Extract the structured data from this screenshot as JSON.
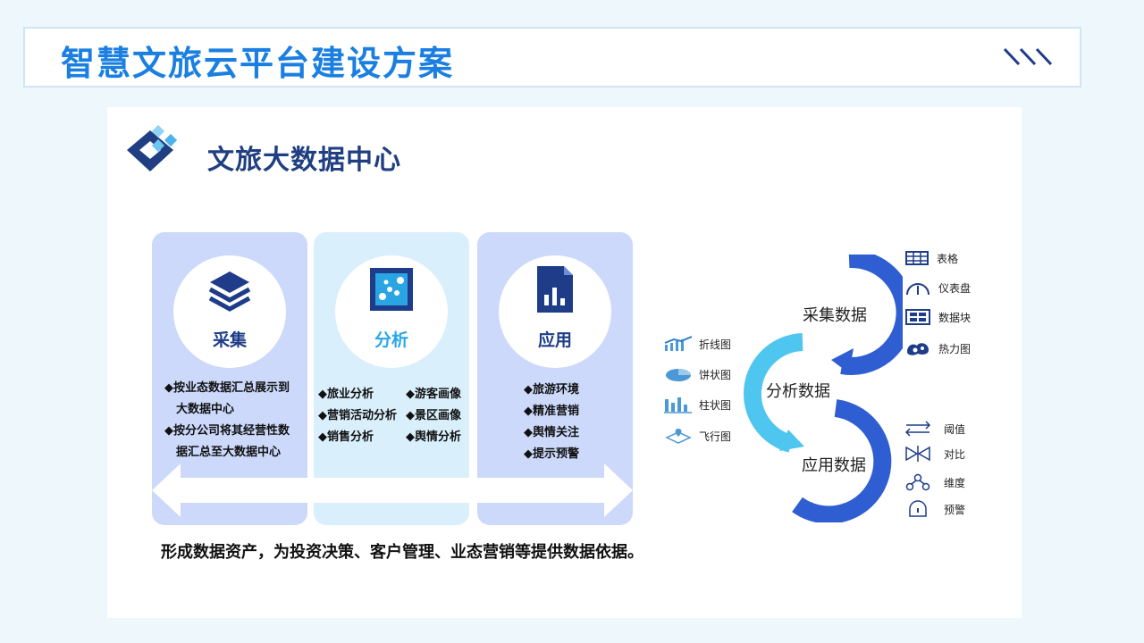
{
  "page": {
    "title": "智慧文旅云平台建设方案"
  },
  "header": {
    "logo_title": "文旅大数据中心"
  },
  "columns": [
    {
      "label": "采集",
      "icon": "layers-icon",
      "bullets": [
        "◆按业态数据汇总展示到",
        "大数据中心",
        "◆按分公司将其经营性数",
        "据汇总至大数据中心"
      ]
    },
    {
      "label": "分析",
      "icon": "scatter-chart-icon",
      "bullets_left": [
        "◆旅业分析",
        "◆营销活动分析",
        "◆销售分析"
      ],
      "bullets_right": [
        "◆游客画像",
        "◆景区画像",
        "◆舆情分析"
      ]
    },
    {
      "label": "应用",
      "icon": "report-document-icon",
      "bullets": [
        "◆旅游环境",
        "◆精准营销",
        "◆舆情关注",
        "◆提示预警"
      ]
    }
  ],
  "conclusion": "形成数据资产，为投资决策、客户管理、业态营销等提供数据依据。",
  "chart_types": [
    {
      "label": "折线图",
      "icon": "line-chart-icon"
    },
    {
      "label": "饼状图",
      "icon": "pie-chart-icon"
    },
    {
      "label": "柱状图",
      "icon": "bar-chart-icon"
    },
    {
      "label": "飞行图",
      "icon": "flight-map-icon"
    }
  ],
  "cycle": {
    "collect": "采集数据",
    "analyze": "分析数据",
    "apply": "应用数据"
  },
  "display_types": [
    {
      "label": "表格",
      "icon": "table-icon"
    },
    {
      "label": "仪表盘",
      "icon": "gauge-icon"
    },
    {
      "label": "数据块",
      "icon": "data-block-icon"
    },
    {
      "label": "热力图",
      "icon": "heatmap-icon"
    }
  ],
  "alert_types": [
    {
      "label": "阈值",
      "icon": "threshold-icon"
    },
    {
      "label": "对比",
      "icon": "compare-icon"
    },
    {
      "label": "维度",
      "icon": "dimension-icon"
    },
    {
      "label": "预警",
      "icon": "warning-icon"
    }
  ],
  "colors": {
    "title": "#1a7fe0",
    "dark_blue": "#1e3c88",
    "light_blue": "#28a7e8",
    "col_blue": "#ccd9fb",
    "col_cyan": "#d9effc"
  }
}
